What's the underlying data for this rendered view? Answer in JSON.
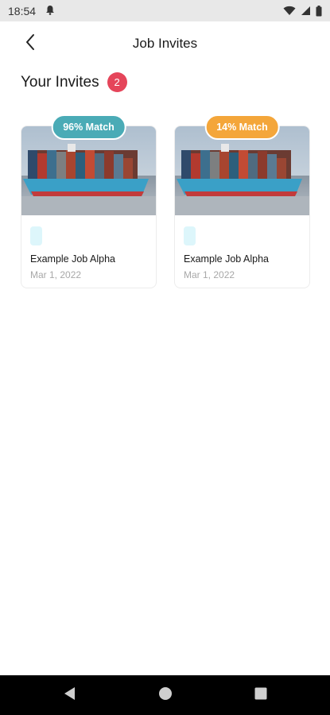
{
  "status_bar": {
    "time": "18:54",
    "icons": [
      "notification-icon",
      "wifi-icon",
      "signal-icon",
      "battery-icon"
    ]
  },
  "header": {
    "title": "Job Invites",
    "back_icon": "chevron-left-icon"
  },
  "section": {
    "title": "Your Invites",
    "count": "2"
  },
  "invites": [
    {
      "match": "96% Match",
      "match_color": "#4aabb6",
      "title": "Example Job Alpha",
      "date": "Mar 1, 2022"
    },
    {
      "match": "14% Match",
      "match_color": "#f4a63a",
      "title": "Example Job Alpha",
      "date": "Mar 1, 2022"
    }
  ],
  "nav": {
    "icons": [
      "back-triangle-icon",
      "home-circle-icon",
      "recents-square-icon"
    ]
  },
  "colors": {
    "badge_red": "#e5455a",
    "tag_pill": "#ddf6fb"
  }
}
